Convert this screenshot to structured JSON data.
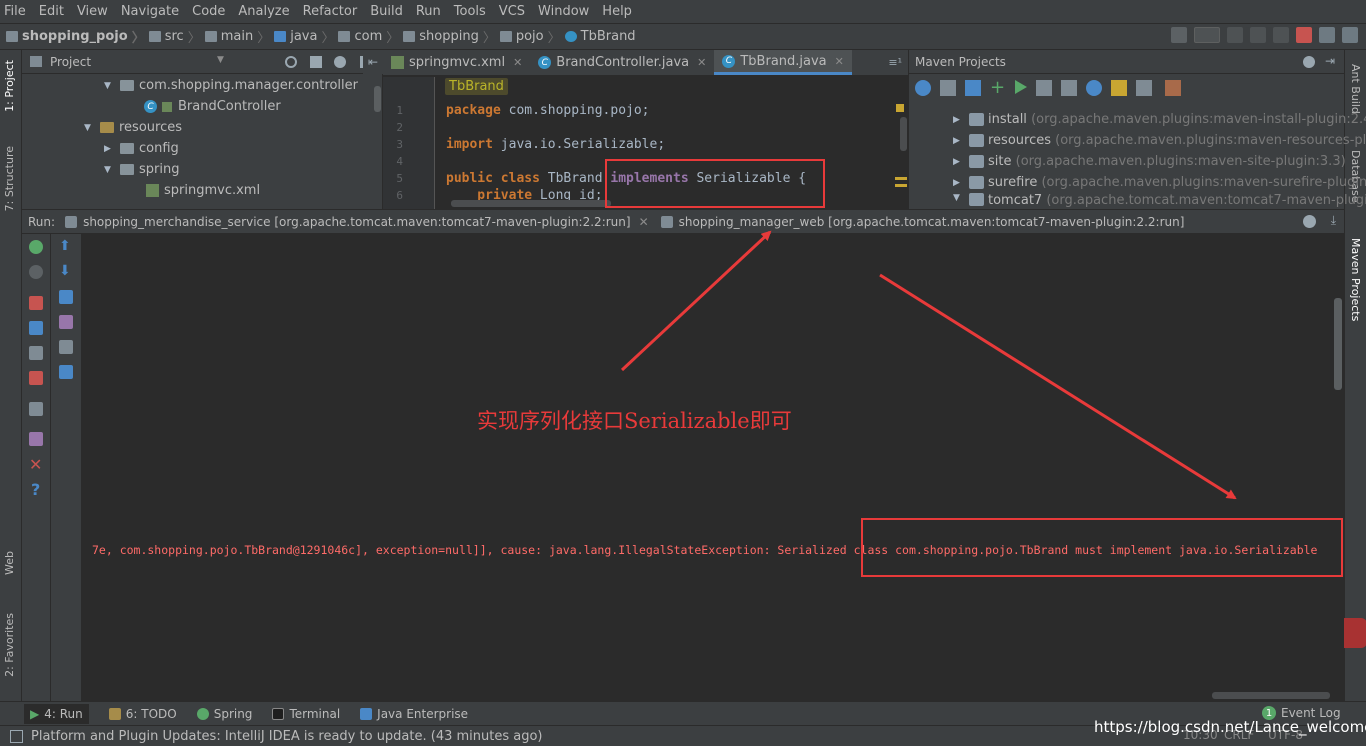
{
  "menu": [
    "File",
    "Edit",
    "View",
    "Navigate",
    "Code",
    "Analyze",
    "Refactor",
    "Build",
    "Run",
    "Tools",
    "VCS",
    "Window",
    "Help"
  ],
  "breadcrumbs": [
    "shopping_pojo",
    "src",
    "main",
    "java",
    "com",
    "shopping",
    "pojo",
    "TbBrand"
  ],
  "left_strip": {
    "project": "1: Project",
    "structure": "7: Structure",
    "web": "Web",
    "favorites": "2: Favorites"
  },
  "right_strip": {
    "ant": "Ant Build",
    "database": "Database",
    "maven": "Maven Projects"
  },
  "project_panel": {
    "title": "Project",
    "rows": [
      {
        "label": "com.shopping.manager.controller",
        "kind": "package"
      },
      {
        "label": "BrandController",
        "kind": "class"
      },
      {
        "label": "resources",
        "kind": "folder"
      },
      {
        "label": "config",
        "kind": "folder"
      },
      {
        "label": "spring",
        "kind": "folder"
      },
      {
        "label": "springmvc.xml",
        "kind": "xml"
      }
    ]
  },
  "editor": {
    "tabs": [
      {
        "label": "springmvc.xml",
        "active": false
      },
      {
        "label": "BrandController.java",
        "active": false
      },
      {
        "label": "TbBrand.java",
        "active": true
      }
    ],
    "breadcrumb_chip": "TbBrand",
    "line_numbers": [
      "1",
      "2",
      "3",
      "4",
      "5",
      "6"
    ],
    "lines": [
      {
        "kw": "package",
        "rest": " com.shopping.pojo;"
      },
      {
        "kw": "",
        "rest": ""
      },
      {
        "kw": "import",
        "rest": " java.io.Serializable;"
      },
      {
        "kw": "",
        "rest": ""
      },
      {
        "kw": "public class",
        "rest": " TbBrand ",
        "kw2": "implements",
        "rest2": " Serializable {"
      },
      {
        "kw": "    private",
        "rest": " Long id;"
      }
    ]
  },
  "maven_panel": {
    "title": "Maven Projects",
    "rows": [
      {
        "name": "install",
        "detail": "(org.apache.maven.plugins:maven-install-plugin:2.4)"
      },
      {
        "name": "resources",
        "detail": "(org.apache.maven.plugins:maven-resources-plugi"
      },
      {
        "name": "site",
        "detail": "(org.apache.maven.plugins:maven-site-plugin:3.3)"
      },
      {
        "name": "surefire",
        "detail": "(org.apache.maven.plugins:maven-surefire-plugin:2.1"
      },
      {
        "name": "tomcat7",
        "detail": "(org.apache.tomcat.maven:tomcat7-maven-plugin:2."
      }
    ]
  },
  "run_bar": {
    "label": "Run:",
    "tabs": [
      "shopping_merchandise_service [org.apache.tomcat.maven:tomcat7-maven-plugin:2.2:run]",
      "shopping_manager_web [org.apache.tomcat.maven:tomcat7-maven-plugin:2.2:run]"
    ]
  },
  "console": {
    "line": "7e, com.shopping.pojo.TbBrand@1291046c], exception=null]], cause: java.lang.IllegalStateException: Serialized class com.shopping.pojo.TbBrand must implement java.io.Serializable"
  },
  "annotation": "实现序列化接口Serializable即可",
  "bottom_tabs": [
    {
      "label": "4: Run",
      "active": true
    },
    {
      "label": "6: TODO",
      "active": false
    },
    {
      "label": "Spring",
      "active": false
    },
    {
      "label": "Terminal",
      "active": false
    },
    {
      "label": "Java Enterprise",
      "active": false
    }
  ],
  "event_log": "Event Log",
  "event_count": "1",
  "status": {
    "message": "Platform and Plugin Updates: IntelliJ IDEA is ready to update. (43 minutes ago)",
    "position": "10:30",
    "line_sep": "CRLF",
    "encoding": "UTF-8",
    "watermark": "https://blog.csdn.net/Lance_welcome"
  },
  "colors": {
    "annotation_red": "#e83a3a",
    "console_red": "#ff6b68",
    "accent": "#4a88c7"
  }
}
